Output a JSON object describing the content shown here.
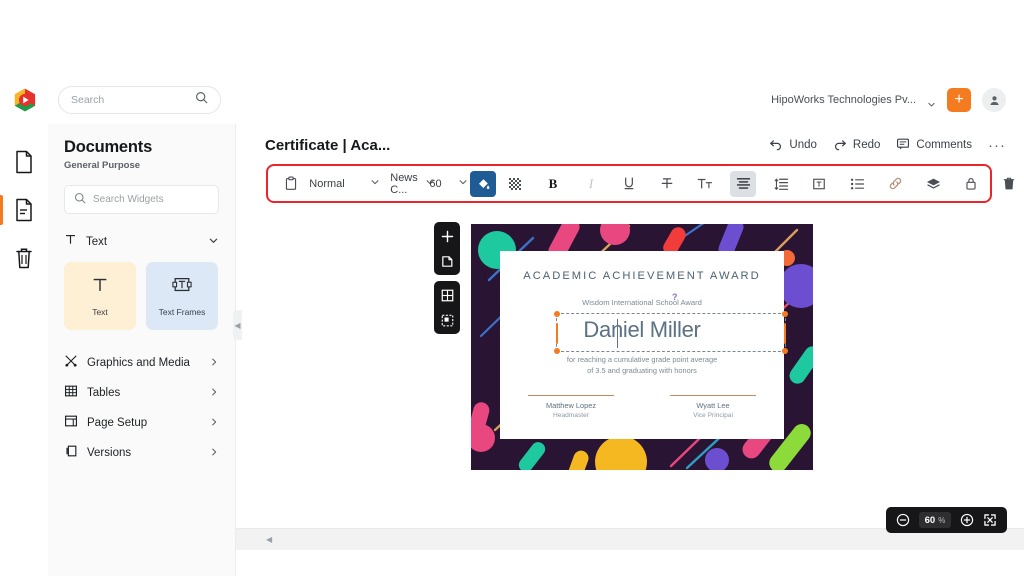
{
  "topbar": {
    "logo_icon": "app-logo-hexagon",
    "search_placeholder": "Search",
    "search_icon": "search-icon",
    "org_name": "HipoWorks Technologies Pv...",
    "org_chevron_icon": "chevron-down-icon",
    "add_label": "+",
    "add_icon": "plus-icon",
    "avatar_icon": "user-avatar-icon"
  },
  "rail": {
    "items": [
      {
        "icon": "document-blank-icon",
        "active": false
      },
      {
        "icon": "document-lines-icon",
        "active": true
      },
      {
        "icon": "trash-icon",
        "active": false
      }
    ]
  },
  "sidebar": {
    "title": "Documents",
    "subtitle": "General Purpose",
    "search_placeholder": "Search Widgets",
    "search_icon": "search-icon",
    "section": {
      "icon": "text-T-icon",
      "label": "Text",
      "chevron_icon": "chevron-down-icon"
    },
    "cards": [
      {
        "label": "Text",
        "icon": "text-T-icon"
      },
      {
        "label": "Text Frames",
        "icon": "text-frame-icon"
      }
    ],
    "nav": [
      {
        "label": "Graphics and Media",
        "icon": "graphics-media-icon",
        "chevron": "chevron-right-icon"
      },
      {
        "label": "Tables",
        "icon": "table-grid-icon",
        "chevron": "chevron-right-icon"
      },
      {
        "label": "Page Setup",
        "icon": "page-setup-icon",
        "chevron": "chevron-right-icon"
      },
      {
        "label": "Versions",
        "icon": "versions-layers-icon",
        "chevron": "chevron-right-icon"
      }
    ],
    "collapse_icon": "chevron-left-icon"
  },
  "document": {
    "title": "Certificate | Aca...",
    "undo_label": "Undo",
    "undo_icon": "undo-arrow-icon",
    "redo_label": "Redo",
    "redo_icon": "redo-arrow-icon",
    "comments_label": "Comments",
    "comments_icon": "comment-bubble-icon",
    "more_label": "···",
    "more_icon": "more-horizontal-icon"
  },
  "toolbar": {
    "highlight_color": "#e8262b",
    "paste_icon": "clipboard-icon",
    "style_value": "Normal",
    "style_chevron_icon": "chevron-down-icon",
    "font_value": "News C...",
    "font_chevron_icon": "chevron-down-icon",
    "size_value": "60",
    "size_chevron_icon": "chevron-down-icon",
    "items": [
      {
        "icon": "fill-color-bucket-icon",
        "state": "active-blue"
      },
      {
        "icon": "transparency-grid-icon",
        "state": "normal"
      },
      {
        "icon": "bold-icon",
        "label": "B",
        "state": "normal"
      },
      {
        "icon": "italic-icon",
        "label": "I",
        "state": "dim"
      },
      {
        "icon": "underline-icon",
        "label": "U",
        "state": "normal"
      },
      {
        "icon": "strikethrough-icon",
        "label": "T",
        "state": "normal"
      },
      {
        "icon": "text-size-icon",
        "label": "Tt",
        "state": "normal"
      },
      {
        "icon": "align-text-icon",
        "state": "active-grey"
      },
      {
        "icon": "line-spacing-icon",
        "state": "normal"
      },
      {
        "icon": "text-box-icon",
        "state": "normal"
      },
      {
        "icon": "bullet-list-icon",
        "state": "normal"
      },
      {
        "icon": "link-icon",
        "state": "normal"
      },
      {
        "icon": "layers-icon",
        "state": "normal"
      },
      {
        "icon": "lock-icon",
        "state": "normal"
      },
      {
        "icon": "delete-trash-icon",
        "state": "normal"
      }
    ]
  },
  "canvas": {
    "float_tools": [
      {
        "icon": "add-plus-icon"
      },
      {
        "icon": "duplicate-page-icon"
      },
      {
        "icon": "grid-view-icon"
      },
      {
        "icon": "select-area-icon"
      }
    ],
    "certificate": {
      "background_color": "#2a1433",
      "title": "ACADEMIC ACHIEVEMENT AWARD",
      "subtitle": "Wisdom International School Award",
      "recipient": "Daniel Miller",
      "body_line1": "for reaching a cumulative grade point average",
      "body_line2": "of 3.5 and graduating with honors",
      "question_mark": "?",
      "signatures": [
        {
          "name": "Matthew Lopez",
          "role": "Headmaster"
        },
        {
          "name": "Wyatt Lee",
          "role": "Vice Principal"
        }
      ]
    }
  },
  "footer": {
    "scroll_left_icon": "scroll-left-arrow-icon",
    "zoom_out_icon": "zoom-out-circle-icon",
    "zoom_value": "60",
    "zoom_unit": "%",
    "zoom_in_icon": "zoom-in-circle-icon",
    "fit_screen_icon": "fit-to-screen-icon"
  }
}
